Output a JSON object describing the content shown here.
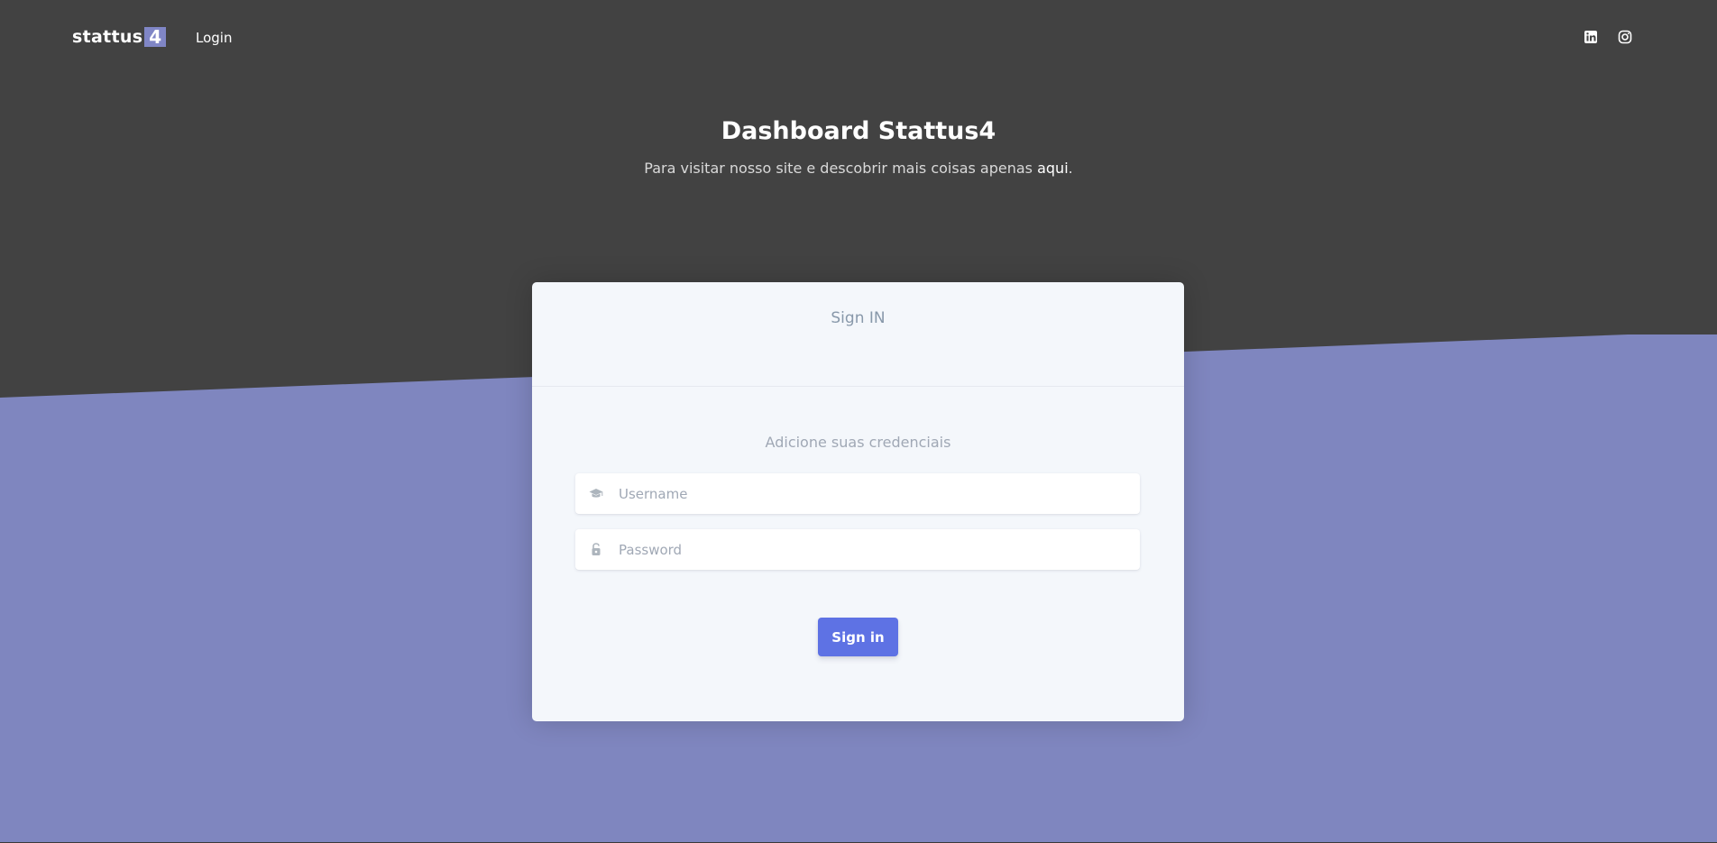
{
  "navbar": {
    "brand_text": "stattus",
    "brand_box": "4",
    "login_label": "Login",
    "social_icons": [
      "linkedin-icon",
      "instagram-icon"
    ]
  },
  "hero": {
    "title": "Dashboard Stattus4",
    "subtitle_prefix": "Para visitar nosso site e descobrir mais coisas apenas ",
    "subtitle_link": "aqui",
    "subtitle_suffix": "."
  },
  "card": {
    "header_title": "Sign IN",
    "subtitle": "Adicione suas credenciais",
    "username_placeholder": "Username",
    "username_icon": "graduation-cap-icon",
    "password_placeholder": "Password",
    "password_icon": "lock-icon",
    "signin_label": "Sign in"
  },
  "colors": {
    "dark_bg": "#424242",
    "purple_bg": "#7f86bf",
    "card_bg": "#f4f7fb",
    "button": "#5e72e4",
    "brand_box": "#8086c6"
  }
}
